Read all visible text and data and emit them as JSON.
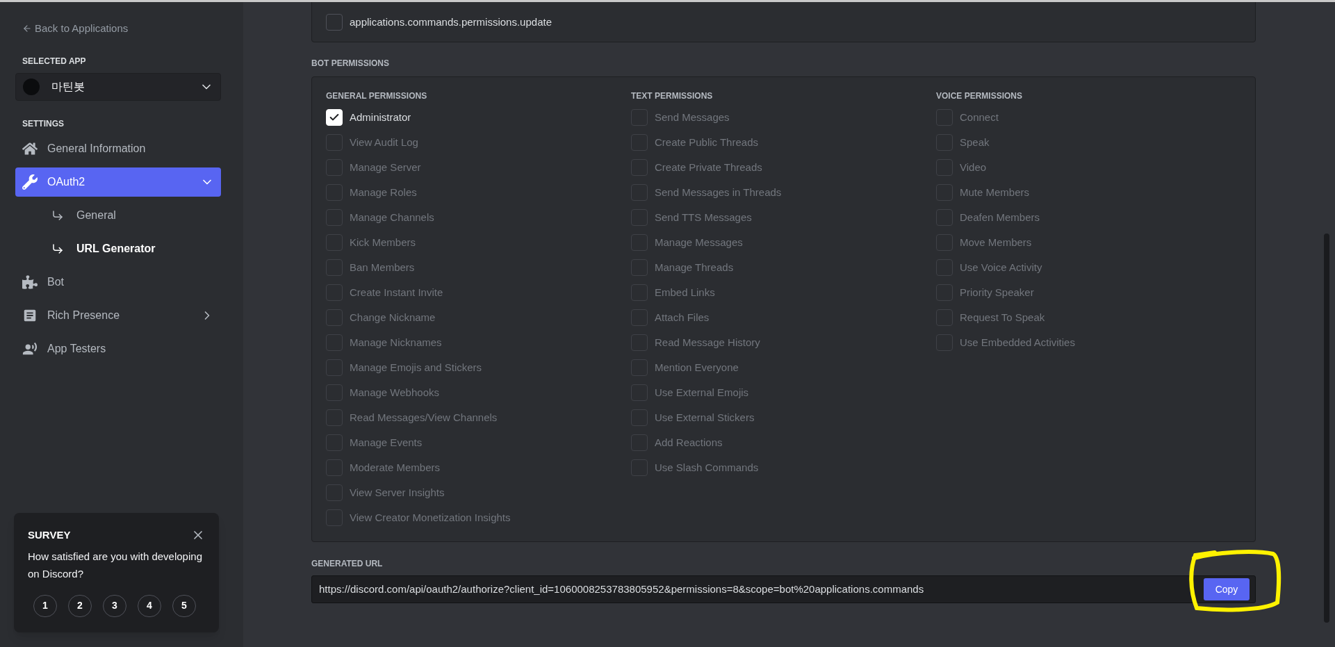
{
  "sidebar": {
    "back_link": "Back to Applications",
    "selected_app_label": "SELECTED APP",
    "selected_app": "마틴봇",
    "settings_label": "SETTINGS",
    "items": [
      {
        "label": "General Information",
        "selected": false
      },
      {
        "label": "OAuth2",
        "selected": true,
        "expanded": true,
        "children": [
          {
            "label": "General",
            "selected": false
          },
          {
            "label": "URL Generator",
            "selected": true
          }
        ]
      },
      {
        "label": "Bot",
        "selected": false
      },
      {
        "label": "Rich Presence",
        "selected": false,
        "expanded": false
      },
      {
        "label": "App Testers",
        "selected": false
      }
    ]
  },
  "survey": {
    "title": "SURVEY",
    "question": "How satisfied are you with developing on Discord?",
    "ratings": [
      "1",
      "2",
      "3",
      "4",
      "5"
    ]
  },
  "scopes": [
    {
      "label": "applications.commands.permissions.update",
      "checked": false,
      "disabled": false
    }
  ],
  "bot_permissions": {
    "title": "BOT PERMISSIONS",
    "groups": [
      {
        "title": "GENERAL PERMISSIONS",
        "items": [
          {
            "label": "Administrator",
            "checked": true,
            "disabled": false
          },
          {
            "label": "View Audit Log",
            "checked": false,
            "disabled": true
          },
          {
            "label": "Manage Server",
            "checked": false,
            "disabled": true
          },
          {
            "label": "Manage Roles",
            "checked": false,
            "disabled": true
          },
          {
            "label": "Manage Channels",
            "checked": false,
            "disabled": true
          },
          {
            "label": "Kick Members",
            "checked": false,
            "disabled": true
          },
          {
            "label": "Ban Members",
            "checked": false,
            "disabled": true
          },
          {
            "label": "Create Instant Invite",
            "checked": false,
            "disabled": true
          },
          {
            "label": "Change Nickname",
            "checked": false,
            "disabled": true
          },
          {
            "label": "Manage Nicknames",
            "checked": false,
            "disabled": true
          },
          {
            "label": "Manage Emojis and Stickers",
            "checked": false,
            "disabled": true
          },
          {
            "label": "Manage Webhooks",
            "checked": false,
            "disabled": true
          },
          {
            "label": "Read Messages/View Channels",
            "checked": false,
            "disabled": true
          },
          {
            "label": "Manage Events",
            "checked": false,
            "disabled": true
          },
          {
            "label": "Moderate Members",
            "checked": false,
            "disabled": true
          },
          {
            "label": "View Server Insights",
            "checked": false,
            "disabled": true
          },
          {
            "label": "View Creator Monetization Insights",
            "checked": false,
            "disabled": true
          }
        ]
      },
      {
        "title": "TEXT PERMISSIONS",
        "items": [
          {
            "label": "Send Messages",
            "checked": false,
            "disabled": true
          },
          {
            "label": "Create Public Threads",
            "checked": false,
            "disabled": true
          },
          {
            "label": "Create Private Threads",
            "checked": false,
            "disabled": true
          },
          {
            "label": "Send Messages in Threads",
            "checked": false,
            "disabled": true
          },
          {
            "label": "Send TTS Messages",
            "checked": false,
            "disabled": true
          },
          {
            "label": "Manage Messages",
            "checked": false,
            "disabled": true
          },
          {
            "label": "Manage Threads",
            "checked": false,
            "disabled": true
          },
          {
            "label": "Embed Links",
            "checked": false,
            "disabled": true
          },
          {
            "label": "Attach Files",
            "checked": false,
            "disabled": true
          },
          {
            "label": "Read Message History",
            "checked": false,
            "disabled": true
          },
          {
            "label": "Mention Everyone",
            "checked": false,
            "disabled": true
          },
          {
            "label": "Use External Emojis",
            "checked": false,
            "disabled": true
          },
          {
            "label": "Use External Stickers",
            "checked": false,
            "disabled": true
          },
          {
            "label": "Add Reactions",
            "checked": false,
            "disabled": true
          },
          {
            "label": "Use Slash Commands",
            "checked": false,
            "disabled": true
          }
        ]
      },
      {
        "title": "VOICE PERMISSIONS",
        "items": [
          {
            "label": "Connect",
            "checked": false,
            "disabled": true
          },
          {
            "label": "Speak",
            "checked": false,
            "disabled": true
          },
          {
            "label": "Video",
            "checked": false,
            "disabled": true
          },
          {
            "label": "Mute Members",
            "checked": false,
            "disabled": true
          },
          {
            "label": "Deafen Members",
            "checked": false,
            "disabled": true
          },
          {
            "label": "Move Members",
            "checked": false,
            "disabled": true
          },
          {
            "label": "Use Voice Activity",
            "checked": false,
            "disabled": true
          },
          {
            "label": "Priority Speaker",
            "checked": false,
            "disabled": true
          },
          {
            "label": "Request To Speak",
            "checked": false,
            "disabled": true
          },
          {
            "label": "Use Embedded Activities",
            "checked": false,
            "disabled": true
          }
        ]
      }
    ]
  },
  "generated_url": {
    "label": "GENERATED URL",
    "value": "https://discord.com/api/oauth2/authorize?client_id=1060008253783805952&permissions=8&scope=bot%20applications.commands",
    "button": "Copy"
  }
}
